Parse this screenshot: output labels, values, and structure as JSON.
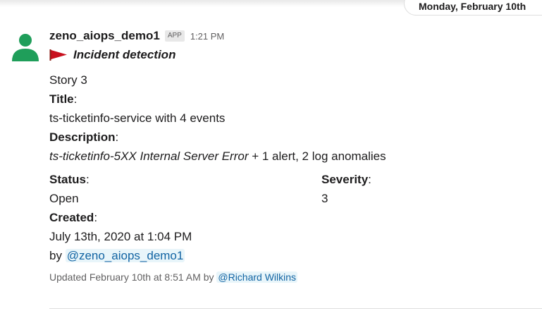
{
  "date_divider": "Monday, February 10th",
  "message": {
    "sender": "zeno_aiops_demo1",
    "badge": "APP",
    "time": "1:21 PM",
    "subtitle_icon": "red-flag-icon",
    "subtitle": "Incident detection",
    "story": "Story 3",
    "title_label": "Title",
    "title_value": "ts-ticketinfo-service with 4 events",
    "description_label": "Description",
    "description_italic": "ts-ticketinfo-5XX Internal Server Error",
    "description_rest": " + 1 alert, 2 log anomalies",
    "status_label": "Status",
    "status_value": "Open",
    "severity_label": "Severity",
    "severity_value": "3",
    "created_label": "Created",
    "created_value": "July 13th, 2020 at 1:04 PM",
    "created_by_prefix": "by ",
    "created_by": "@zeno_aiops_demo1",
    "updated_prefix": "Updated February 10th at 8:51 AM by ",
    "updated_by": "@Richard Wilkins"
  },
  "colors": {
    "flag": "#c8101e",
    "avatar": "#1f9e5a",
    "mention": "#1264a3"
  }
}
